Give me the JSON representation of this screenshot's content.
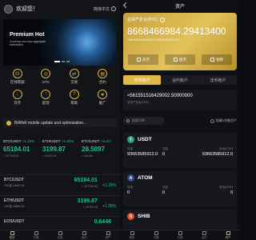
{
  "colors": {
    "accent": "#d8b54a",
    "green": "#19c39b",
    "bg": "#131418"
  },
  "home": {
    "greeting": "欢迎您！",
    "lang_label": "简体中文",
    "banner": {
      "title": "Premium Hot",
      "subtitle": "Currency one stop aggregate transaction"
    },
    "quick": [
      {
        "label": "在线客服",
        "icon": "headset-icon"
      },
      {
        "label": "OTC",
        "icon": "otc-icon"
      },
      {
        "label": "交易",
        "icon": "trade-icon"
      },
      {
        "label": "合约",
        "icon": "contract-icon"
      },
      {
        "label": "充币",
        "icon": "deposit-icon"
      },
      {
        "label": "提现",
        "icon": "withdraw-icon"
      },
      {
        "label": "帮助",
        "icon": "help-icon"
      },
      {
        "label": "推广",
        "icon": "promote-icon"
      }
    ],
    "notice": "BitWell mobile update and optimisation...",
    "tickers": [
      {
        "pair": "BTC/USDT",
        "change": "+1.15%",
        "price": "65184.01",
        "cny": "≈ 427746.54"
      },
      {
        "pair": "ETH/USDT",
        "change": "+1.25%",
        "price": "3199.87",
        "cny": "≈ 20702.15"
      },
      {
        "pair": "ETC/USDT",
        "change": "+3.4%",
        "price": "28.5097",
        "cny": "≈ 184.54"
      }
    ],
    "market": [
      {
        "pair": "BTC/USDT",
        "vol": "24H量 18860.03",
        "price": "65184.01",
        "cny": "≈ 427746.54",
        "change": "+1.15%"
      },
      {
        "pair": "ETH/USDT",
        "vol": "24H量 18860.03",
        "price": "3199.87",
        "cny": "≈ 20702.15",
        "change": "+1.25%"
      },
      {
        "pair": "EOS/USDT",
        "vol": "",
        "price": "0.6448",
        "cny": "",
        "change": ""
      }
    ],
    "nav": [
      "首页",
      "行情",
      "交易",
      "合约",
      "资产"
    ]
  },
  "assets": {
    "title": "资产",
    "card": {
      "label": "总资产折合(BTC)",
      "value": "8668466984.29413400",
      "sub": "≈561551516429002.50000000(CNY)",
      "actions": [
        "充币",
        "提币",
        "划转"
      ]
    },
    "tabs": [
      "币币账户",
      "合约账户",
      "法币账户"
    ],
    "account_value": "≈561551516429002.50000000",
    "account_sub": "总资产折合(CNY)",
    "search_placeholder": "搜索币种",
    "hide_zero": "隐藏0余额资产",
    "list": [
      {
        "name": "USDT",
        "color": "#26a17b",
        "glyph": "T",
        "labels": [
          "可用",
          "冻结",
          "折合(CNY)"
        ],
        "values": [
          "93663585912.0",
          "0",
          "93663585912.0"
        ]
      },
      {
        "name": "ATOM",
        "color": "#3a4b8c",
        "glyph": "A",
        "labels": [
          "可用",
          "冻结",
          "折合(CNY)"
        ],
        "values": [
          "0",
          "0",
          "0"
        ]
      },
      {
        "name": "SHIB",
        "color": "#e0512a",
        "glyph": "S",
        "labels": [],
        "values": []
      }
    ],
    "nav": [
      "首页",
      "行情",
      "交易",
      "合约",
      "资产"
    ]
  }
}
